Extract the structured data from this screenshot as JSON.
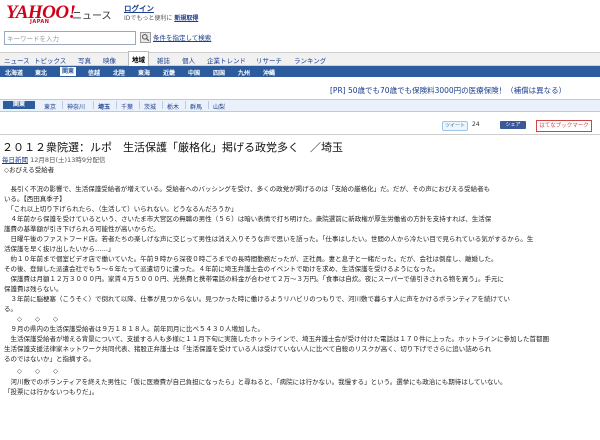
{
  "header": {
    "logo_text": "YAHOO!",
    "logo_sub": "JAPAN",
    "site_name": "ニュース",
    "login_label": "ログイン",
    "login_sub": "IDでもっと便利に",
    "register_label": "新規取得"
  },
  "search": {
    "placeholder": "キーワードを入力",
    "cond_link": "条件を指定して検索"
  },
  "nav": {
    "items": [
      "ニュース",
      "トピックス",
      "写真",
      "映像",
      "地域",
      "雑誌",
      "個人",
      "企業トレンド",
      "リサーチ",
      "ランキング"
    ],
    "active": "地域"
  },
  "region": {
    "items": [
      "北海道",
      "東北",
      "関東",
      "信越",
      "北陸",
      "東海",
      "近畿",
      "中国",
      "四国",
      "九州",
      "沖縄"
    ],
    "active": "関東"
  },
  "ad": {
    "pr": "[PR]",
    "text": "50歳でも70歳でも保険料3000円の医療保険！（補償は異なる）"
  },
  "pref": {
    "tag": "関東",
    "items": [
      "東京",
      "神奈川",
      "埼玉",
      "千葉",
      "茨城",
      "栃木",
      "群馬",
      "山梨"
    ]
  },
  "share": {
    "tweet_label": "ツイート",
    "tweet_count": "24",
    "share_label": "シェア",
    "bookmark_label": "はてなブックマーク"
  },
  "article": {
    "headline": "２０１２衆院選：ルポ　生活保護「厳格化」掲げる政党多く　／埼玉",
    "source": "毎日新聞",
    "date": "12月8日(土)13時9分配信",
    "lines": [
      "◇おびえる受給者",
      "",
      "　長引く不況の影響で、生活保護受給者が増えている。受給者へのバッシングを受け、多くの政党が掲げるのは「支給の厳格化」だ。だが、その声におびえる受給者も",
      "いる。【西田真季子】",
      "　「これ以上切り下げられたら、（生活して）いられない。どうなるんだろうか」",
      "　４年前から保護を受けているという、さいたま市大宮区の無職の男性（５６）は暗い表情で打ち明けた。衆院選前に新政権が厚生労働省の方針を支持すれば、生活保",
      "護費の基準額が引き下げられる可能性が高いからだ。",
      "　日曜午後のファストフード店。若者たちの楽しげな声に交じって男性は消え入りそうな声で思いを語った。「仕事はしたい。世間の人から冷たい目で見られている気がするから。生",
      "活保護を早く抜け出したいから……」",
      "　約１０年前まで個室ビデオ店で働いていた。午前９時から深夜０時ごろまでの長時間勤務だったが、正社員。妻と息子と一緒だった。だが、会社は倒産し、離婚した。",
      "その後、登録した派遣会社でも５～６年たって派遣切りに遭った。４年前に埼玉弁護士会のイベントで助けを求め、生活保護を受けるようになった。",
      "　保護費は月額１２万３０００円。家賃４万５０００円、光熱費と携帯電話の料金が合わせて２万～３万円。「食事は自炊。夜にスーパーで値引きされる物を買う」。手元に",
      "保護費は残らない。",
      "　３年前に脳梗塞（こうそく）で倒れて以降、仕事が見つからない。見つかった時に働けるようリハビリのつもりで、河川敷で暮らす人に声をかけるボランティアを続けてい",
      "る。",
      "　　◇　　◇　　◇",
      "　９月の県内の生活保護受給者は９万１８１８人。前年同月に比べ５４３０人増加した。",
      "　生活保護受給者が増える背景について、支援する人も多様に１１月下旬に実施したホットラインで、埼玉弁護士会が受け付けた電話は１７０件に上った。ホットラインに参加した首都圏",
      "生活保護支援法律家ネットワーク共同代表、猪股正弁護士は「生活保護を受けている人は受けていない人に比べて自殺のリスクが高く、切り下げでさらに追い詰められ",
      "るのではないか」と指摘する。",
      "　　◇　　◇　　◇",
      "　河川敷でのボランティアを終えた男性に「仮に医療費が自己負担になったら」と尋ねると、「病院には行かない。我慢する」という。選挙にも政治にも期待はしていない。",
      "「投票には行かないつもりだ」。"
    ]
  }
}
